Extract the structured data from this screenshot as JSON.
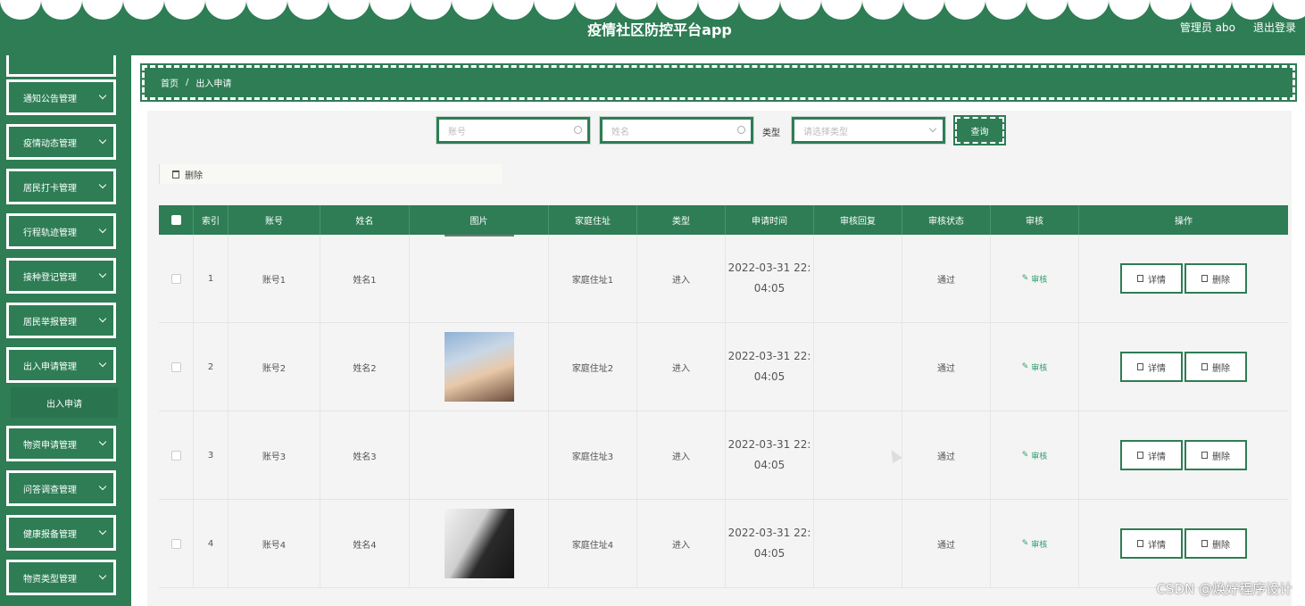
{
  "header": {
    "title": "疫情社区防控平台app",
    "admin_label": "管理员 abo",
    "logout_label": "退出登录"
  },
  "sidebar": {
    "items": [
      {
        "label": "通知公告管理"
      },
      {
        "label": "疫情动态管理"
      },
      {
        "label": "居民打卡管理"
      },
      {
        "label": "行程轨迹管理"
      },
      {
        "label": "接种登记管理"
      },
      {
        "label": "居民举报管理"
      },
      {
        "label": "出入申请管理"
      },
      {
        "label": "物资申请管理"
      },
      {
        "label": "问答调查管理"
      },
      {
        "label": "健康报备管理"
      },
      {
        "label": "物资类型管理"
      }
    ],
    "active_sub": "出入申请"
  },
  "breadcrumb": {
    "home": "首页",
    "sep": "/",
    "current": "出入申请"
  },
  "search": {
    "account_placeholder": "账号",
    "name_placeholder": "姓名",
    "type_label": "类型",
    "type_placeholder": "请选择类型",
    "query_label": "查询"
  },
  "toolbar": {
    "delete_label": "删除"
  },
  "table": {
    "headers": [
      "索引",
      "账号",
      "姓名",
      "图片",
      "家庭住址",
      "类型",
      "申请时间",
      "审核回复",
      "审核状态",
      "审核",
      "操作"
    ],
    "rows": [
      {
        "index": "1",
        "account": "账号1",
        "name": "姓名1",
        "address": "家庭住址1",
        "type": "进入",
        "time1": "2022-03-31 22:",
        "time2": "04:05",
        "reply": "",
        "status": "通过"
      },
      {
        "index": "2",
        "account": "账号2",
        "name": "姓名2",
        "address": "家庭住址2",
        "type": "进入",
        "time1": "2022-03-31 22:",
        "time2": "04:05",
        "reply": "",
        "status": "通过"
      },
      {
        "index": "3",
        "account": "账号3",
        "name": "姓名3",
        "address": "家庭住址3",
        "type": "进入",
        "time1": "2022-03-31 22:",
        "time2": "04:05",
        "reply": "",
        "status": "通过"
      },
      {
        "index": "4",
        "account": "账号4",
        "name": "姓名4",
        "address": "家庭住址4",
        "type": "进入",
        "time1": "2022-03-31 22:",
        "time2": "04:05",
        "reply": "",
        "status": "通过"
      }
    ],
    "audit_label": "审核",
    "detail_label": "详情",
    "row_delete_label": "删除"
  },
  "watermark": "CSDN @焕好程序设计",
  "colors": {
    "primary": "#2e7d55",
    "audit": "#2e9e6e"
  }
}
